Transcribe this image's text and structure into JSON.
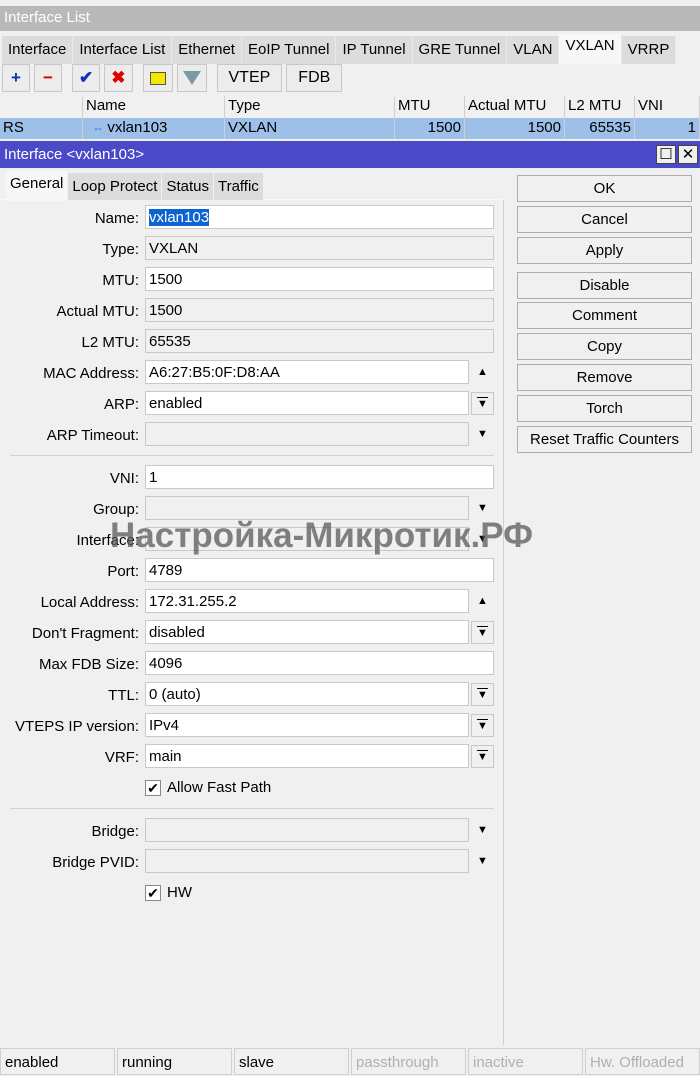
{
  "list_window": {
    "title": "Interface List",
    "tabs": [
      "Interface",
      "Interface List",
      "Ethernet",
      "EoIP Tunnel",
      "IP Tunnel",
      "GRE Tunnel",
      "VLAN",
      "VXLAN",
      "VRRP"
    ],
    "active_tab": "VXLAN",
    "toolbar": {
      "add": "+",
      "remove": "−",
      "enable": "✔",
      "disable": "✖",
      "comment": "comment-icon",
      "filter": "filter-icon",
      "vtep": "VTEP",
      "fdb": "FDB"
    },
    "columns": [
      "",
      "Name",
      "Type",
      "MTU",
      "Actual MTU",
      "L2 MTU",
      "VNI"
    ],
    "rows": [
      {
        "flags": "RS",
        "name": "vxlan103",
        "type": "VXLAN",
        "mtu": "1500",
        "actual_mtu": "1500",
        "l2_mtu": "65535",
        "vni": "1"
      }
    ]
  },
  "dialog": {
    "title": "Interface <vxlan103>",
    "tabs": [
      "General",
      "Loop Protect",
      "Status",
      "Traffic"
    ],
    "buttons": [
      "OK",
      "Cancel",
      "Apply",
      "Disable",
      "Comment",
      "Copy",
      "Remove",
      "Torch",
      "Reset Traffic Counters"
    ],
    "fields": [
      {
        "label": "Name:",
        "value": "vxlan103",
        "kind": "text"
      },
      {
        "label": "Type:",
        "value": "VXLAN",
        "kind": "ro"
      },
      {
        "label": "MTU:",
        "value": "1500",
        "kind": "text"
      },
      {
        "label": "Actual MTU:",
        "value": "1500",
        "kind": "ro"
      },
      {
        "label": "L2 MTU:",
        "value": "65535",
        "kind": "ro"
      },
      {
        "label": "MAC Address:",
        "value": "A6:27:B5:0F:D8:AA",
        "kind": "up"
      },
      {
        "label": "ARP:",
        "value": "enabled",
        "kind": "drop"
      },
      {
        "label": "ARP Timeout:",
        "value": "",
        "kind": "down"
      },
      {
        "sep": true
      },
      {
        "label": "VNI:",
        "value": "1",
        "kind": "text"
      },
      {
        "label": "Group:",
        "value": "",
        "kind": "down"
      },
      {
        "label": "Interface:",
        "value": "",
        "kind": "down"
      },
      {
        "label": "Port:",
        "value": "4789",
        "kind": "text"
      },
      {
        "label": "Local Address:",
        "value": "172.31.255.2",
        "kind": "up"
      },
      {
        "label": "Don't Fragment:",
        "value": "disabled",
        "kind": "drop"
      },
      {
        "label": "Max FDB Size:",
        "value": "4096",
        "kind": "text"
      },
      {
        "label": "TTL:",
        "value": "0 (auto)",
        "kind": "drop"
      },
      {
        "label": "VTEPS IP version:",
        "value": "IPv4",
        "kind": "drop"
      },
      {
        "label": "VRF:",
        "value": "main",
        "kind": "drop"
      },
      {
        "label": "Allow Fast Path",
        "checked": true,
        "kind": "check"
      },
      {
        "sep": true
      },
      {
        "label": "Bridge:",
        "value": "",
        "kind": "down"
      },
      {
        "label": "Bridge PVID:",
        "value": "",
        "kind": "down"
      },
      {
        "label": "HW",
        "checked": true,
        "kind": "check"
      }
    ]
  },
  "watermark": "Настройка-Микротик.РФ",
  "status_bar": [
    {
      "text": "enabled",
      "active": true
    },
    {
      "text": "running",
      "active": true
    },
    {
      "text": "slave",
      "active": true
    },
    {
      "text": "passthrough",
      "active": false
    },
    {
      "text": "inactive",
      "active": false
    },
    {
      "text": "Hw. Offloaded",
      "active": false
    }
  ],
  "colors": {
    "dialog_title": "#4a4ac8",
    "selection": "#9cc0e8",
    "accent": "#0a64d2"
  }
}
